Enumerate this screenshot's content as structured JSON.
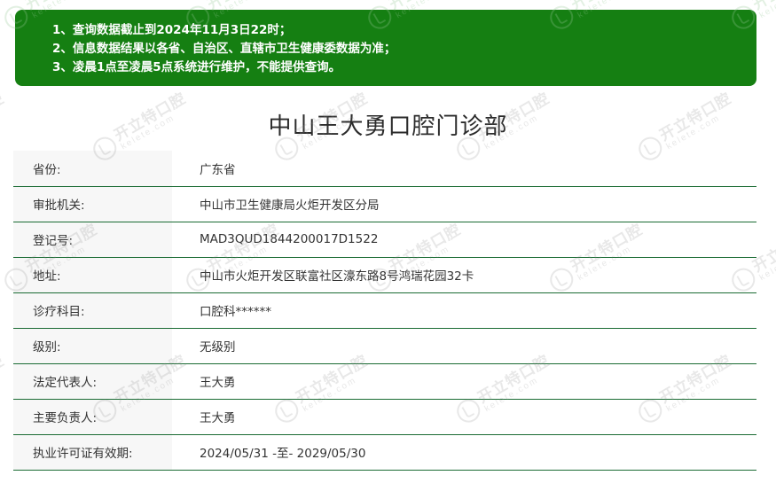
{
  "notice": {
    "lines": [
      "1、查询数据截止到2024年11月3日22时；",
      "2、信息数据结果以各省、自治区、直辖市卫生健康委数据为准；",
      "3、凌晨1点至凌晨5点系统进行维护，不能提供查询。"
    ],
    "background_color": "#157f12",
    "text_color": "#ffffff"
  },
  "page_title": "中山王大勇口腔门诊部",
  "info_table": {
    "border_color": "#1a6b33",
    "label_background": "#f7f7f7",
    "rows": [
      {
        "label": "省份:",
        "value": "广东省"
      },
      {
        "label": "审批机关:",
        "value": "中山市卫生健康局火炬开发区分局"
      },
      {
        "label": "登记号:",
        "value": "MAD3QUD1844200017D1522"
      },
      {
        "label": "地址:",
        "value": "中山市火炬开发区联富社区濠东路8号鸿瑞花园32卡"
      },
      {
        "label": "诊疗科目:",
        "value": "口腔科******"
      },
      {
        "label": "级别:",
        "value": "无级别"
      },
      {
        "label": "法定代表人:",
        "value": "王大勇"
      },
      {
        "label": "主要负责人:",
        "value": "王大勇"
      },
      {
        "label": "执业许可证有效期:",
        "value": "2024/05/31 -至- 2029/05/30"
      }
    ]
  },
  "watermark": {
    "main_text": "开立特口腔",
    "sub_text": "kelete.com",
    "logo_icon": "kelete-circle-logo-icon"
  }
}
